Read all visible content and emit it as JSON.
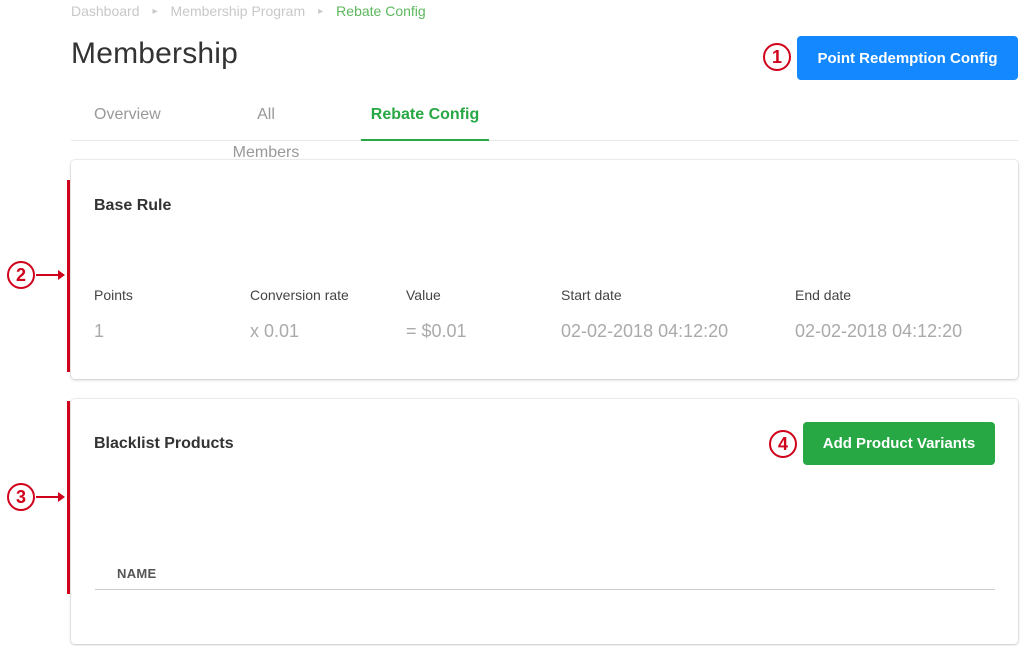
{
  "breadcrumb": {
    "items": [
      "Dashboard",
      "Membership Program",
      "Rebate Config"
    ],
    "separator": "▸"
  },
  "page_title": "Membership",
  "header_button": "Point Redemption Config",
  "tabs": [
    {
      "label": "Overview",
      "active": false
    },
    {
      "label": "All Members",
      "active": false
    },
    {
      "label": "Rebate Config",
      "active": true
    }
  ],
  "base_rule": {
    "title": "Base Rule",
    "columns": [
      "Points",
      "Conversion rate",
      "Value",
      "Start date",
      "End date"
    ],
    "values": [
      "1",
      "x 0.01",
      "= $0.01",
      "02-02-2018 04:12:20",
      "02-02-2018 04:12:20"
    ]
  },
  "blacklist": {
    "title": "Blacklist Products",
    "add_button": "Add Product Variants",
    "table_header": "NAME"
  },
  "annotations": [
    "1",
    "2",
    "3",
    "4"
  ],
  "colors": {
    "primary": "#1488ff",
    "success": "#28a745",
    "annotation": "#d0021b"
  }
}
